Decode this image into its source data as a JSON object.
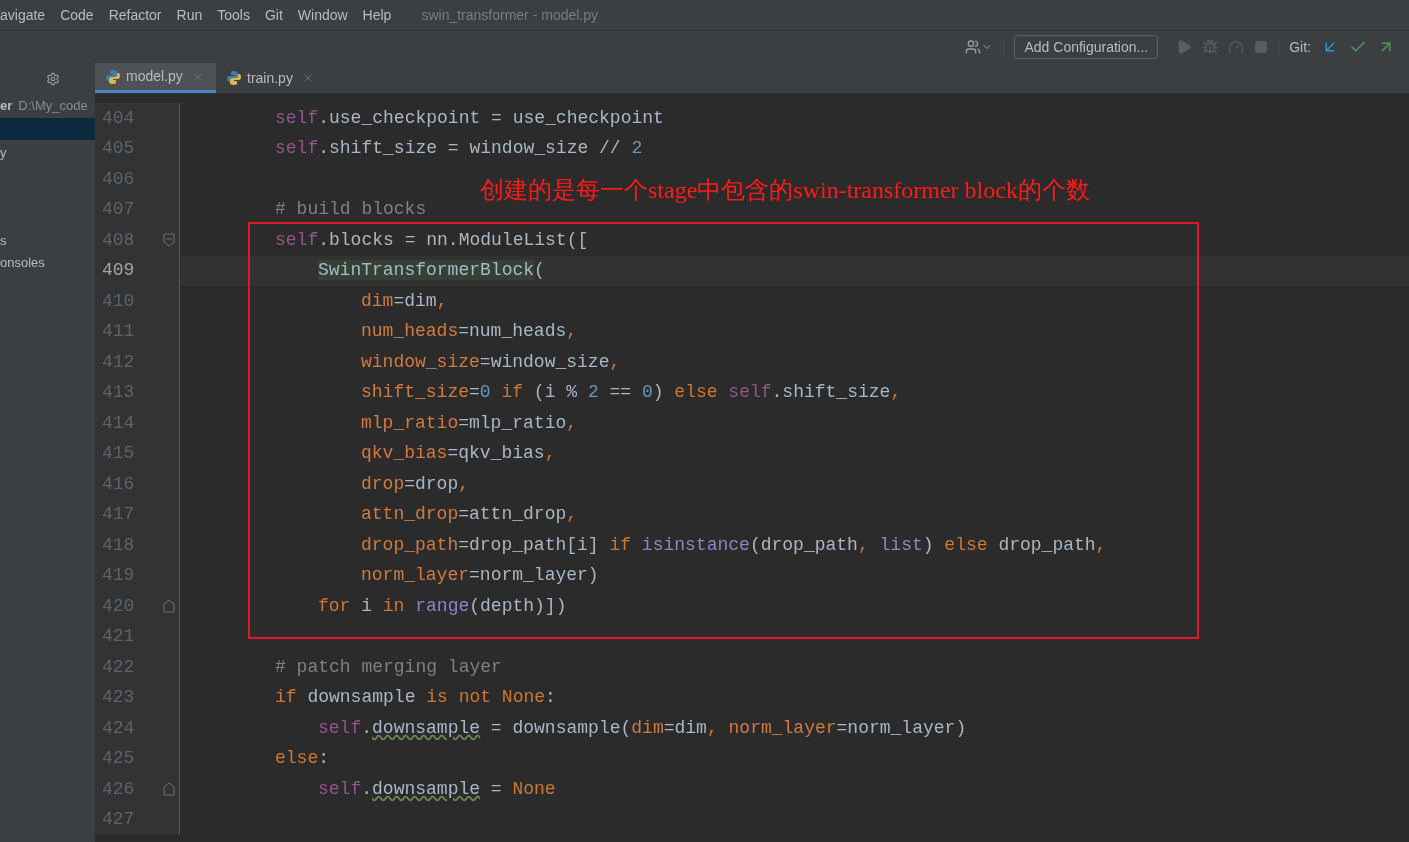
{
  "menu": [
    "avigate",
    "Code",
    "Refactor",
    "Run",
    "Tools",
    "Git",
    "Window",
    "Help"
  ],
  "window": {
    "title": "swin_transformer - model.py"
  },
  "toolbar": {
    "config_button": "Add Configuration...",
    "git_label": "Git:"
  },
  "tabs": [
    {
      "label": "model.py",
      "selected": true
    },
    {
      "label": "train.py",
      "selected": false
    }
  ],
  "sidebar": {
    "path": {
      "name": "er",
      "location": "D:\\My_code"
    },
    "items": [
      {
        "selected": true
      },
      {
        "label": "y",
        "selected": false
      },
      {
        "label": "s",
        "selected": false
      },
      {
        "label": "onsoles",
        "selected": false
      }
    ]
  },
  "annotation": "创建的是每一个stage中包含的swin-transformer block的个数",
  "lines": [
    {
      "number": "404",
      "current": false,
      "tokens": [
        {
          "kind": "self",
          "text": "self"
        },
        {
          "kind": "plain",
          "text": ".use_checkpoint = use_checkpoint"
        }
      ]
    },
    {
      "number": "405",
      "current": false,
      "tokens": [
        {
          "kind": "self",
          "text": "self"
        },
        {
          "kind": "plain",
          "text": ".shift_size = window_size // "
        },
        {
          "kind": "num",
          "text": "2"
        }
      ]
    },
    {
      "number": "406",
      "current": false
    },
    {
      "number": "407",
      "current": false,
      "tokens": [
        {
          "kind": "comment",
          "text": "# build blocks"
        }
      ]
    },
    {
      "number": "408",
      "current": false,
      "fold_start": true,
      "tokens": [
        {
          "kind": "self",
          "text": "self"
        },
        {
          "kind": "plain",
          "text": ".blocks = nn.ModuleList(["
        }
      ],
      "children": [
        {
          "number": "409",
          "current": true,
          "tokens": [
            {
              "kind": "hl",
              "text": "SwinTransformerBlock"
            },
            {
              "kind": "plain",
              "text": "("
            }
          ],
          "children": [
            {
              "number": "410",
              "current": false,
              "tokens": [
                {
                  "kind": "param",
                  "text": "dim"
                },
                {
                  "kind": "plain",
                  "text": "=dim"
                },
                {
                  "kind": "kw",
                  "text": ","
                }
              ]
            },
            {
              "number": "411",
              "current": false,
              "tokens": [
                {
                  "kind": "param",
                  "text": "num_heads"
                },
                {
                  "kind": "plain",
                  "text": "=num_heads"
                },
                {
                  "kind": "kw",
                  "text": ","
                }
              ]
            },
            {
              "number": "412",
              "current": false,
              "tokens": [
                {
                  "kind": "param",
                  "text": "window_size"
                },
                {
                  "kind": "plain",
                  "text": "=window_size"
                },
                {
                  "kind": "kw",
                  "text": ","
                }
              ]
            },
            {
              "number": "413",
              "current": false,
              "tokens": [
                {
                  "kind": "param",
                  "text": "shift_size"
                },
                {
                  "kind": "plain",
                  "text": "="
                },
                {
                  "kind": "num",
                  "text": "0"
                },
                {
                  "kind": "kw",
                  "text": " if"
                },
                {
                  "kind": "plain",
                  "text": " (i % "
                },
                {
                  "kind": "num",
                  "text": "2"
                },
                {
                  "kind": "plain",
                  "text": " == "
                },
                {
                  "kind": "num",
                  "text": "0"
                },
                {
                  "kind": "plain",
                  "text": ") "
                },
                {
                  "kind": "kw",
                  "text": "else"
                },
                {
                  "kind": "self",
                  "text": " self"
                },
                {
                  "kind": "plain",
                  "text": ".shift_size"
                },
                {
                  "kind": "kw",
                  "text": ","
                }
              ]
            },
            {
              "number": "414",
              "current": false,
              "tokens": [
                {
                  "kind": "param",
                  "text": "mlp_ratio"
                },
                {
                  "kind": "plain",
                  "text": "=mlp_ratio"
                },
                {
                  "kind": "kw",
                  "text": ","
                }
              ]
            },
            {
              "number": "415",
              "current": false,
              "tokens": [
                {
                  "kind": "param",
                  "text": "qkv_bias"
                },
                {
                  "kind": "plain",
                  "text": "=qkv_bias"
                },
                {
                  "kind": "kw",
                  "text": ","
                }
              ]
            },
            {
              "number": "416",
              "current": false,
              "tokens": [
                {
                  "kind": "param",
                  "text": "drop"
                },
                {
                  "kind": "plain",
                  "text": "=drop"
                },
                {
                  "kind": "kw",
                  "text": ","
                }
              ]
            },
            {
              "number": "417",
              "current": false,
              "tokens": [
                {
                  "kind": "param",
                  "text": "attn_drop"
                },
                {
                  "kind": "plain",
                  "text": "=attn_drop"
                },
                {
                  "kind": "kw",
                  "text": ","
                }
              ]
            },
            {
              "number": "418",
              "current": false,
              "tokens": [
                {
                  "kind": "param",
                  "text": "drop_path"
                },
                {
                  "kind": "plain",
                  "text": "=drop_path[i] "
                },
                {
                  "kind": "kw",
                  "text": "if"
                },
                {
                  "kind": "builtin",
                  "text": " isinstance"
                },
                {
                  "kind": "plain",
                  "text": "(drop_path"
                },
                {
                  "kind": "kw",
                  "text": ","
                },
                {
                  "kind": "builtin",
                  "text": " list"
                },
                {
                  "kind": "plain",
                  "text": ") "
                },
                {
                  "kind": "kw",
                  "text": "else"
                },
                {
                  "kind": "plain",
                  "text": " drop_path"
                },
                {
                  "kind": "kw",
                  "text": ","
                }
              ]
            },
            {
              "number": "419",
              "current": false,
              "tokens": [
                {
                  "kind": "param",
                  "text": "norm_layer"
                },
                {
                  "kind": "plain",
                  "text": "=norm_layer)"
                }
              ]
            }
          ]
        },
        {
          "number": "420",
          "current": false,
          "fold_end": true,
          "tokens": [
            {
              "kind": "kw",
              "text": "for"
            },
            {
              "kind": "plain",
              "text": " i "
            },
            {
              "kind": "kw",
              "text": "in"
            },
            {
              "kind": "builtin",
              "text": " range"
            },
            {
              "kind": "plain",
              "text": "(depth)])"
            }
          ]
        }
      ]
    },
    {
      "number": "421",
      "current": false
    },
    {
      "number": "422",
      "current": false,
      "tokens": [
        {
          "kind": "comment",
          "text": "# patch merging layer"
        }
      ]
    },
    {
      "number": "423",
      "current": false,
      "tokens": [
        {
          "kind": "kw",
          "text": "if"
        },
        {
          "kind": "plain",
          "text": " downsample "
        },
        {
          "kind": "kw",
          "text": "is not None"
        },
        {
          "kind": "plain",
          "text": ":"
        }
      ],
      "children": [
        {
          "number": "424",
          "current": false,
          "tokens": [
            {
              "kind": "self",
              "text": "self"
            },
            {
              "kind": "plain",
              "text": "."
            },
            {
              "kind": "warn",
              "text": "downsample"
            },
            {
              "kind": "plain",
              "text": " = downsample("
            },
            {
              "kind": "param",
              "text": "dim"
            },
            {
              "kind": "plain",
              "text": "=dim"
            },
            {
              "kind": "kw",
              "text": ","
            },
            {
              "kind": "param",
              "text": " norm_layer"
            },
            {
              "kind": "plain",
              "text": "=norm_layer)"
            }
          ]
        }
      ]
    },
    {
      "number": "425",
      "current": false,
      "tokens": [
        {
          "kind": "kw",
          "text": "else"
        },
        {
          "kind": "plain",
          "text": ":"
        }
      ],
      "children": [
        {
          "number": "426",
          "current": false,
          "fold_end": true,
          "tokens": [
            {
              "kind": "self",
              "text": "self"
            },
            {
              "kind": "plain",
              "text": "."
            },
            {
              "kind": "warn",
              "text": "downsample"
            },
            {
              "kind": "plain",
              "text": " = "
            },
            {
              "kind": "kw",
              "text": "None"
            }
          ]
        }
      ]
    },
    {
      "number": "427",
      "current": false
    }
  ]
}
